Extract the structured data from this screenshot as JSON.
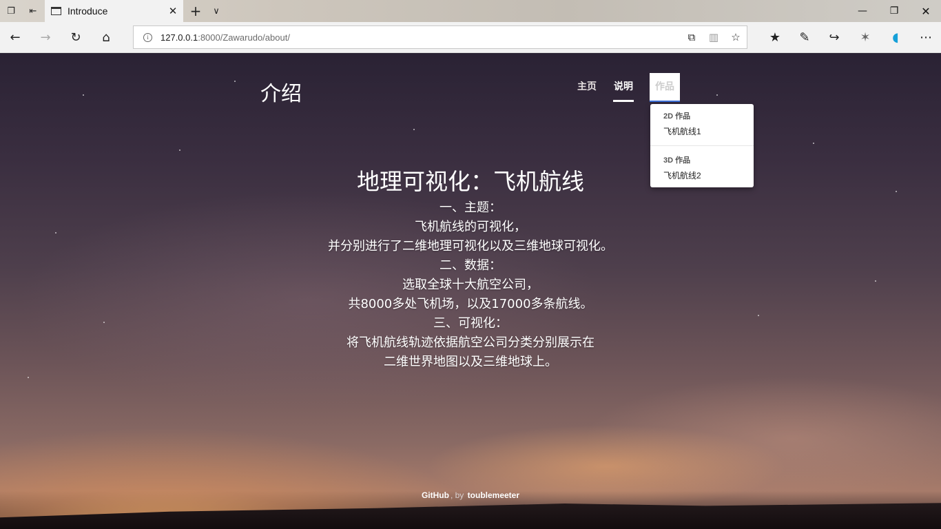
{
  "browser": {
    "tab": {
      "title": "Introduce"
    },
    "url": {
      "host": "127.0.0.1",
      "rest": ":8000/Zawarudo/about/"
    }
  },
  "site": {
    "brand": "介绍",
    "menu": [
      {
        "label": "主页"
      },
      {
        "label": "说明"
      },
      {
        "label": "作品"
      }
    ],
    "dropdown": {
      "group1_header": "2D 作品",
      "group1_item": "飞机航线1",
      "group2_header": "3D 作品",
      "group2_item": "飞机航线2"
    }
  },
  "main": {
    "headline": "地理可视化：飞机航线",
    "lines": [
      "一、主题：",
      "飞机航线的可视化，",
      "并分别进行了二维地理可视化以及三维地球可视化。",
      "二、数据：",
      "选取全球十大航空公司，",
      "共8000多处飞机场，以及17000多条航线。",
      "三、可视化：",
      "将飞机航线轨迹依据航空公司分类分别展示在",
      "二维世界地图以及三维地球上。"
    ]
  },
  "footer": {
    "github": "GitHub",
    "separator": ", by",
    "author": "toublemeeter"
  }
}
